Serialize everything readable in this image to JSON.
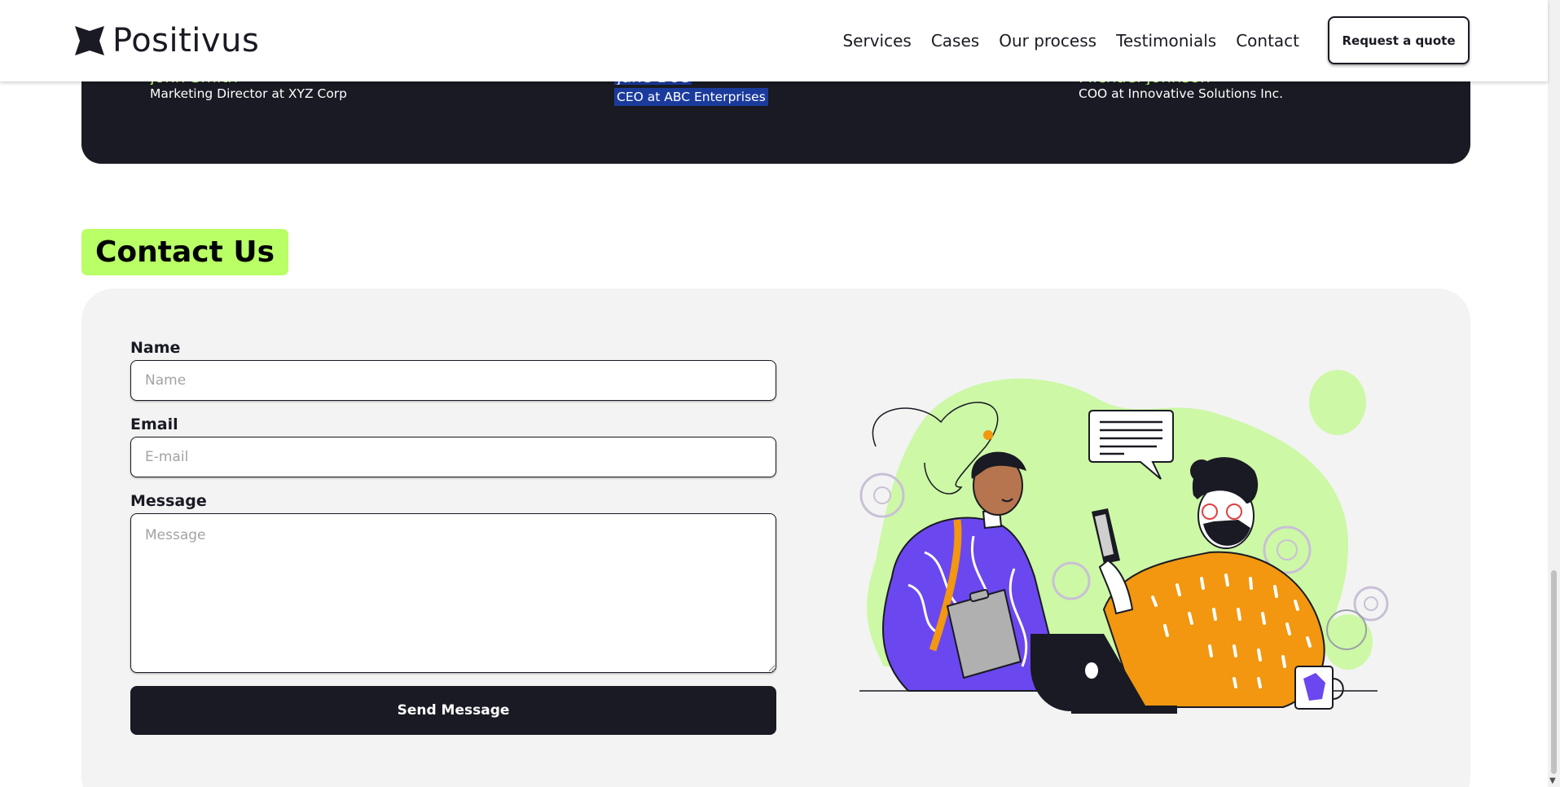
{
  "brand": {
    "name": "Positivus"
  },
  "nav": {
    "links": [
      "Services",
      "Cases",
      "Our process",
      "Testimonials",
      "Contact"
    ],
    "cta_label": "Request a quote"
  },
  "testimonials": [
    {
      "name": "John Smith",
      "role": "Marketing Director at XYZ Corp"
    },
    {
      "name": "Jane Doe",
      "role": "CEO at ABC Enterprises"
    },
    {
      "name": "Michael Johnson",
      "role": "COO at Innovative Solutions Inc."
    }
  ],
  "contact": {
    "heading": "Contact Us",
    "name_label": "Name",
    "name_placeholder": "Name",
    "name_value": "",
    "email_label": "Email",
    "email_placeholder": "E-mail",
    "email_value": "",
    "message_label": "Message",
    "message_placeholder": "Message",
    "message_value": "",
    "submit_label": "Send Message"
  },
  "colors": {
    "accent": "#b9ff66",
    "dark": "#191a23",
    "panel": "#f3f3f3",
    "selection": "#1b3b9c"
  },
  "icons": {
    "logo": "positivus-star-icon",
    "scroll_down": "scroll-down-arrow-icon"
  }
}
